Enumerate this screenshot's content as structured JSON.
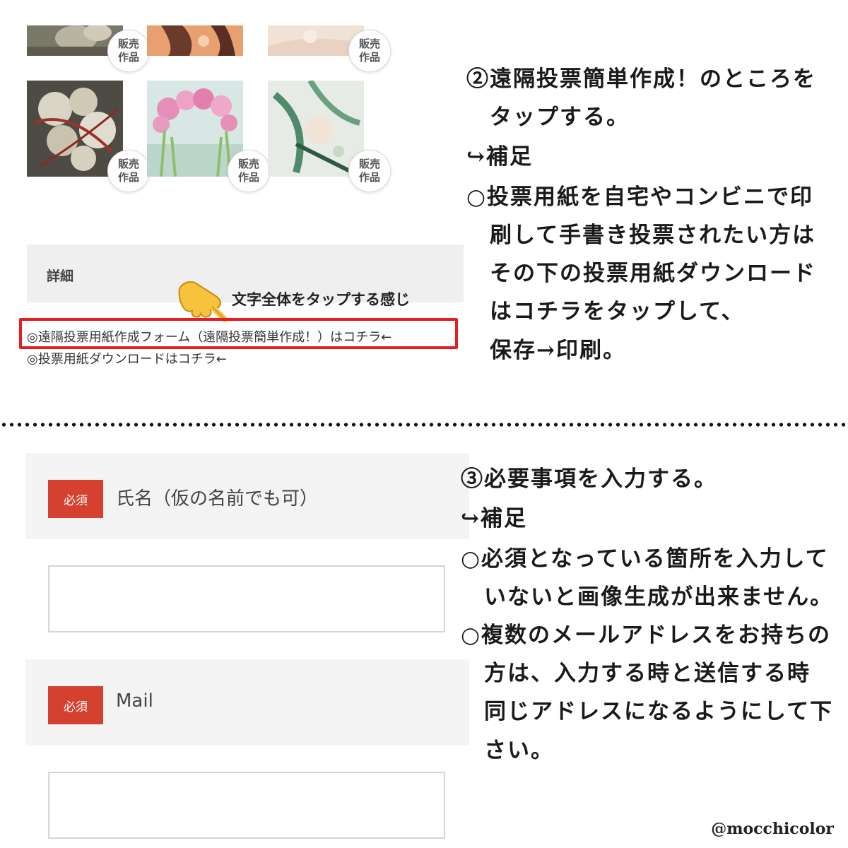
{
  "gallery": {
    "sale_badge_label": "販売\n作品"
  },
  "details": {
    "header_label": "詳細",
    "tap_hint": "文字全体をタップする感じ",
    "links": [
      "◎遠隔投票用紙作成フォーム（遠隔投票簡単作成！）はコチラ←",
      "◎投票用紙ダウンロードはコチラ←"
    ],
    "highlight_color": "#e61e1e"
  },
  "instructions_top": [
    "②遠隔投票簡単作成！のところを",
    "　タップする。",
    "↪補足",
    "○投票用紙を自宅やコンビニで印",
    "　刷して手書き投票されたい方は",
    "　その下の投票用紙ダウンロード",
    "　はコチラをタップして、",
    "　保存→印刷。"
  ],
  "form": {
    "fields": [
      {
        "required_label": "必須",
        "label": "氏名（仮の名前でも可）",
        "value": ""
      },
      {
        "required_label": "必須",
        "label": "Mail",
        "value": ""
      }
    ],
    "required_color": "#d6412f"
  },
  "instructions_bottom": [
    "③必要事項を入力する。",
    "↪補足",
    "○必須となっている箇所を入力して",
    "　いないと画像生成が出来ません。",
    "○複数のメールアドレスをお持ちの",
    "　方は、入力する時と送信する時",
    "　同じアドレスになるようにして下",
    "　さい。"
  ],
  "credit": "@mocchicolor"
}
